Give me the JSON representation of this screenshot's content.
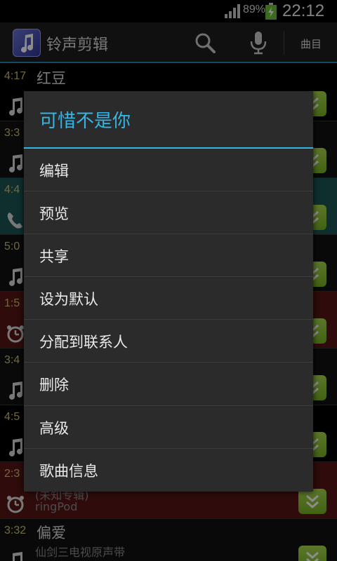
{
  "status_bar": {
    "battery_percent": "89%",
    "time": "22:12"
  },
  "action_bar": {
    "app_title": "铃声剪辑",
    "tracks_label": "曲目"
  },
  "list": {
    "rows": [
      {
        "time": "4:17",
        "title": "红豆",
        "subtitle1": "",
        "subtitle2": "",
        "kind": "music",
        "bg": "#000000"
      },
      {
        "time": "3:3",
        "title": "",
        "subtitle1": "",
        "subtitle2": "",
        "kind": "music",
        "bg": "#111111"
      },
      {
        "time": "4:4",
        "title": "",
        "subtitle1": "",
        "subtitle2": "",
        "kind": "phone",
        "bg": "#1d5656"
      },
      {
        "time": "5:0",
        "title": "",
        "subtitle1": "",
        "subtitle2": "",
        "kind": "music",
        "bg": "#111111"
      },
      {
        "time": "1:5",
        "title": "",
        "subtitle1": "",
        "subtitle2": "",
        "kind": "alarm",
        "bg": "#561515"
      },
      {
        "time": "3:4",
        "title": "",
        "subtitle1": "",
        "subtitle2": "",
        "kind": "music",
        "bg": "#111111"
      },
      {
        "time": "4:5",
        "title": "",
        "subtitle1": "",
        "subtitle2": "",
        "kind": "music",
        "bg": "#000000"
      },
      {
        "time": "2:3",
        "title": "",
        "subtitle1": "(未知专辑)",
        "subtitle2": "ringPod",
        "kind": "alarm",
        "bg": "#561515"
      },
      {
        "time": "3:32",
        "title": "偏爱",
        "subtitle1": "仙剑三电视原声带",
        "subtitle2": "",
        "kind": "music",
        "bg": "#111111"
      }
    ]
  },
  "dialog": {
    "title": "可惜不是你",
    "items": [
      "编辑",
      "预览",
      "共享",
      "设为默认",
      "分配到联系人",
      "删除",
      "高级",
      "歌曲信息"
    ]
  },
  "colors": {
    "accent": "#33b5e5",
    "menu_button_green": "#8cc63f",
    "ringtone_row": "#1d5656",
    "alarm_row": "#561515"
  },
  "icons": {
    "search": "search-icon",
    "mic": "microphone-icon",
    "music": "music-note-icon",
    "phone": "phone-icon",
    "alarm": "alarm-clock-icon",
    "menu": "chevron-down-double-icon"
  }
}
